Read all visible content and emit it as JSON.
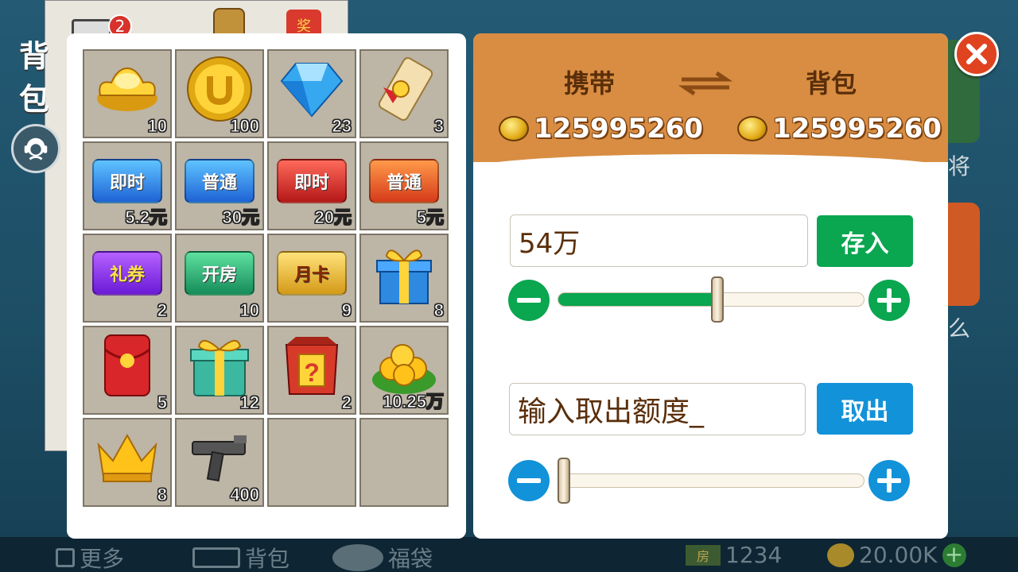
{
  "background": {
    "mail_badge": "2",
    "red_packet_char": "奖",
    "side_label_1": "背",
    "side_label_2": "包",
    "right_text_1": "将",
    "right_text_2": "么"
  },
  "bottom_bar": {
    "more_label": "更多",
    "bag_label": "背包",
    "lucky_label": "福袋",
    "room_icon_text": "房",
    "room_count": "1234",
    "gold_amount": "20.00K"
  },
  "inventory": {
    "items": [
      {
        "icon": "gold-ingot-icon",
        "count": "10"
      },
      {
        "icon": "gold-coin-icon",
        "count": "100"
      },
      {
        "icon": "diamond-icon",
        "count": "23"
      },
      {
        "icon": "scroll-icon",
        "count": "3"
      },
      {
        "icon": "phone-card-instant-icon",
        "card_text": "即时",
        "count": "5.2元"
      },
      {
        "icon": "phone-card-normal-icon",
        "card_text": "普通",
        "count": "30元"
      },
      {
        "icon": "red-card-instant-icon",
        "card_text": "即时",
        "count": "20元"
      },
      {
        "icon": "red-card-normal-icon",
        "card_text": "普通",
        "count": "5元"
      },
      {
        "icon": "coupon-icon",
        "card_text": "礼券",
        "count": "2"
      },
      {
        "icon": "room-card-icon",
        "card_text": "开房",
        "count": "10"
      },
      {
        "icon": "month-card-icon",
        "card_text": "月卡",
        "count": "9"
      },
      {
        "icon": "gift-box-blue-icon",
        "count": "8"
      },
      {
        "icon": "red-envelope-icon",
        "count": "5"
      },
      {
        "icon": "gift-box-green-icon",
        "count": "12"
      },
      {
        "icon": "mystery-box-icon",
        "count": "2"
      },
      {
        "icon": "gold-pile-icon",
        "count": "10.25万"
      },
      {
        "icon": "crown-icon",
        "count": "8"
      },
      {
        "icon": "gun-icon",
        "count": "400"
      },
      {
        "icon": "empty-slot",
        "count": ""
      },
      {
        "icon": "empty-slot",
        "count": ""
      }
    ]
  },
  "exchange": {
    "carry_label": "携带",
    "bag_label": "背包",
    "carry_amount": "125995260",
    "bag_amount": "125995260",
    "deposit_value": "54万",
    "deposit_button": "存入",
    "deposit_slider_fraction": 0.52,
    "withdraw_placeholder": "输入取出额度_",
    "withdraw_button": "取出",
    "withdraw_slider_fraction": 0.0,
    "colors": {
      "header": "#d88d42",
      "deposit": "#0aa650",
      "withdraw": "#1292d8",
      "close": "#e0431f"
    }
  }
}
